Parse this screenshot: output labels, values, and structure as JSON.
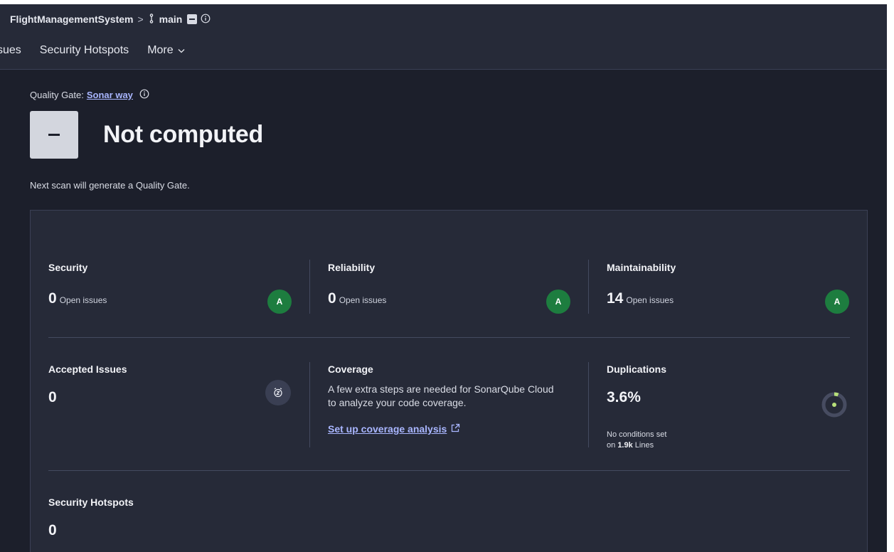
{
  "header": {
    "project": "FlightManagementSystem",
    "separator": ">",
    "branch": "main",
    "tabs": [
      "sues",
      "Security Hotspots",
      "More"
    ]
  },
  "quality_gate": {
    "label": "Quality Gate:",
    "link": "Sonar way",
    "status": "Not computed",
    "note": "Next scan will generate a Quality Gate."
  },
  "metrics": {
    "security": {
      "title": "Security",
      "value": "0",
      "unit": "Open issues",
      "grade": "A"
    },
    "reliability": {
      "title": "Reliability",
      "value": "0",
      "unit": "Open issues",
      "grade": "A"
    },
    "maintainability": {
      "title": "Maintainability",
      "value": "14",
      "unit": "Open issues",
      "grade": "A"
    },
    "accepted": {
      "title": "Accepted Issues",
      "value": "0"
    },
    "coverage": {
      "title": "Coverage",
      "text": "A few extra steps are needed for SonarQube Cloud to analyze your code coverage.",
      "link": "Set up coverage analysis"
    },
    "duplications": {
      "title": "Duplications",
      "value": "3.6%",
      "note_prefix": "No conditions set",
      "note_on": "on",
      "lines": "1.9k",
      "lines_label": "Lines"
    },
    "hotspots": {
      "title": "Security Hotspots",
      "value": "0"
    }
  },
  "colors": {
    "grade_a": "#1d7d3f",
    "link": "#a9b6ff",
    "background": "#1c1f2b",
    "panel": "#262a38"
  }
}
